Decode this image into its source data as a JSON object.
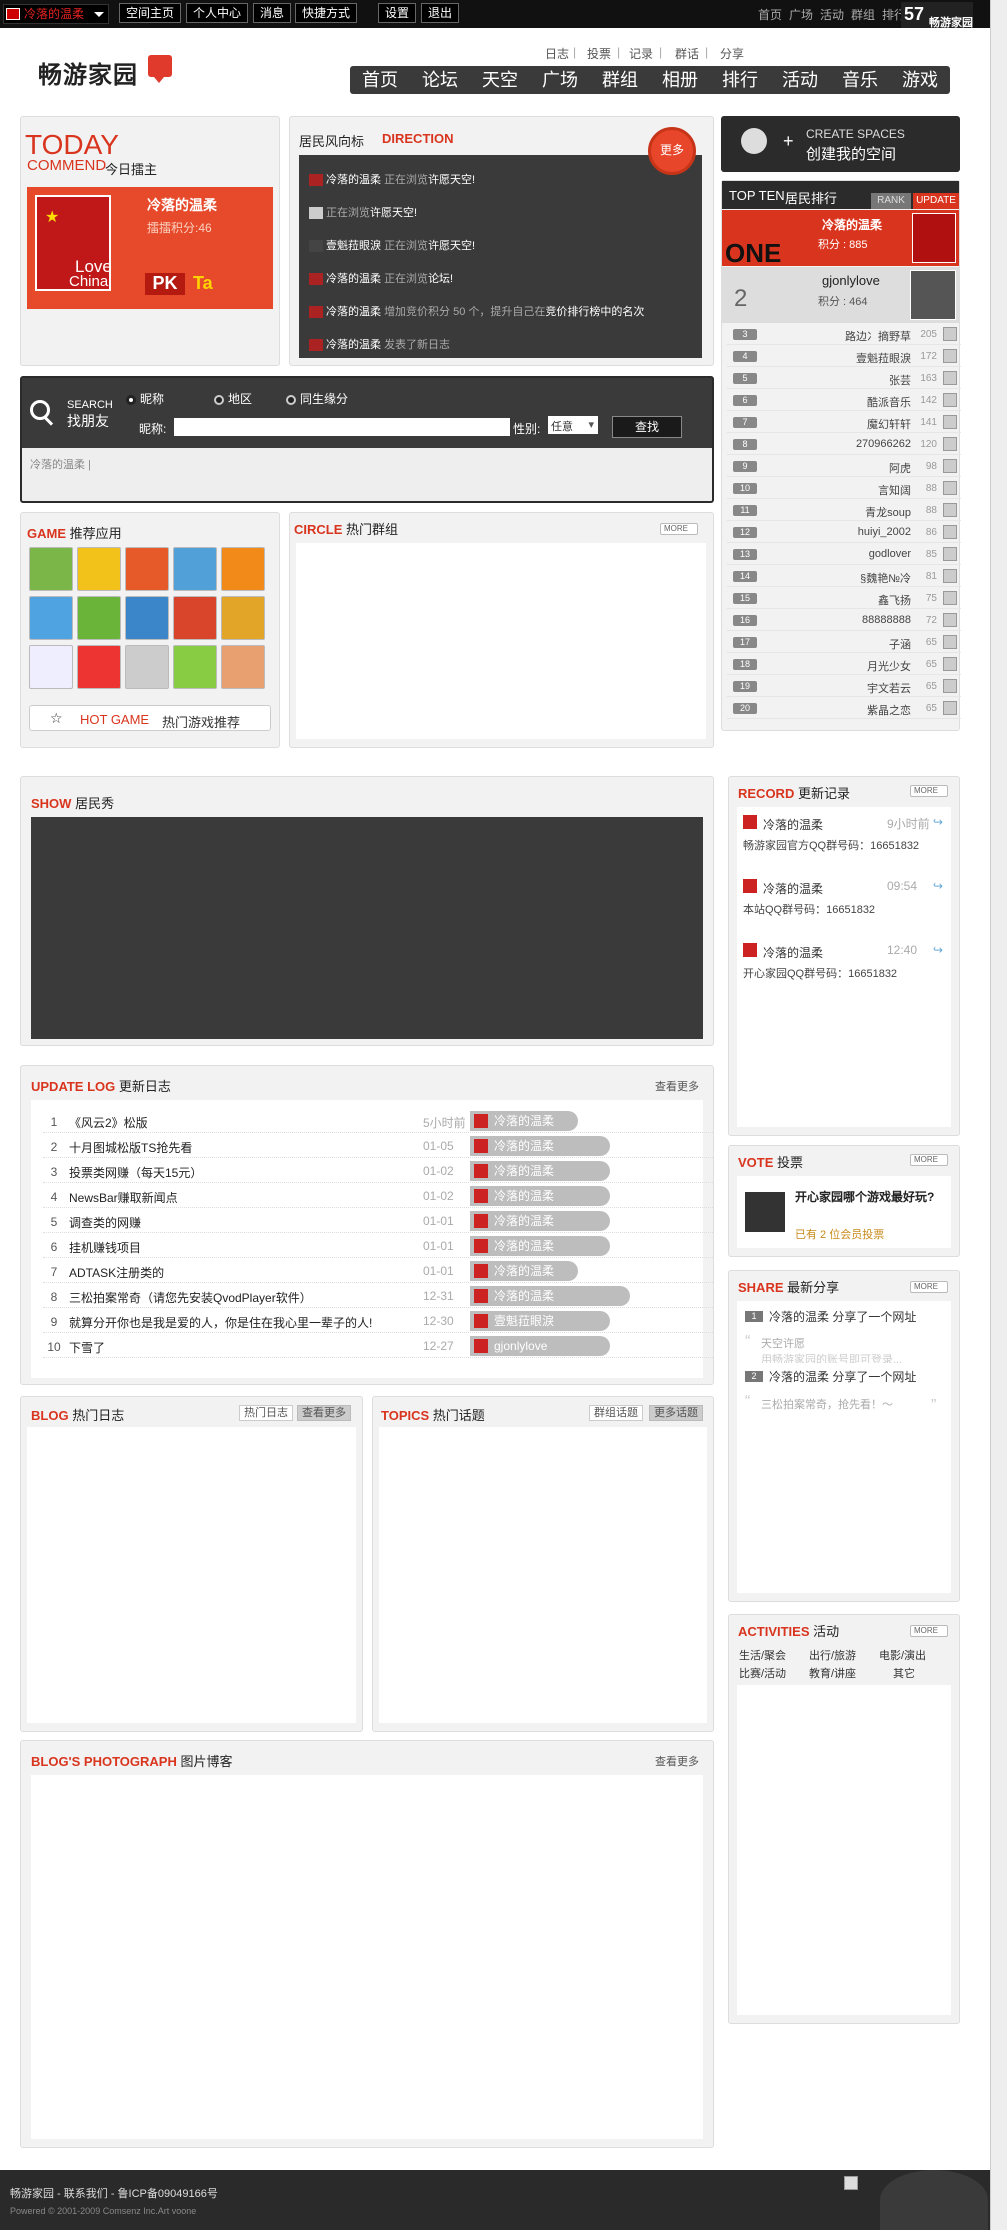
{
  "topbar": {
    "user": "冷落的温柔",
    "links": [
      "空间主页",
      "个人中心",
      "消息",
      "快捷方式",
      "设置",
      "退出"
    ],
    "right_links": [
      "首页",
      "广场",
      "活动",
      "群组",
      "排行"
    ],
    "brand": "57",
    "brand_sub": "畅游家园"
  },
  "logo": {
    "text": "畅游家园"
  },
  "subnav": [
    "日志",
    "投票",
    "记录",
    "群话",
    "分享"
  ],
  "mainnav": [
    "首页",
    "论坛",
    "天空",
    "广场",
    "群组",
    "相册",
    "排行",
    "活动",
    "音乐",
    "游戏"
  ],
  "today": {
    "title": "TODAY",
    "sub_en": "COMMEND",
    "sub_cn": "今日擂主",
    "name": "冷落的温柔",
    "score_label": "擂擂积分:46",
    "img_text1": "Love",
    "img_text2": "China",
    "pk": "PK",
    "ta": "Ta"
  },
  "direction": {
    "title_cn": "居民风向标",
    "title_en": "DIRECTION",
    "badge": "更多",
    "items": [
      {
        "user": "冷落的温柔",
        "action": "正在浏览",
        "target": "许愿天空!"
      },
      {
        "user": "",
        "action": "正在浏览",
        "target": "许愿天空!"
      },
      {
        "user": "壹魁菈眼淚",
        "action": "正在浏览",
        "target": "许愿天空!"
      },
      {
        "user": "冷落的温柔",
        "action": "正在浏览",
        "target": "论坛!"
      },
      {
        "user": "冷落的温柔",
        "action": "增加竞价积分 50 个，提升自己在",
        "target": "竞价排行榜中的名次"
      },
      {
        "user": "冷落的温柔",
        "action": "发表了新日志",
        "target": ""
      }
    ]
  },
  "create_spaces": {
    "en": "CREATE SPACES",
    "cn": "创建我的空间"
  },
  "search": {
    "en": "SEARCH",
    "cn": "找朋友",
    "options": [
      "昵称",
      "地区",
      "同生缘分"
    ],
    "nick_label": "昵称:",
    "gender_label": "性别:",
    "gender_value": "任意",
    "button": "查找",
    "history": "冷落的温柔 |"
  },
  "topten": {
    "title_en": "TOP TEN",
    "title_cn": "居民排行",
    "tabs": [
      "RANK",
      "UPDATE"
    ],
    "first": {
      "rank_word": "ONE",
      "name": "冷落的温柔",
      "score": "积分 : 885"
    },
    "second": {
      "rank": "2",
      "name": "gjonlylove",
      "score": "积分 : 464"
    },
    "rows": [
      {
        "rank": "3",
        "name": "路边冫摘野草",
        "score": "205"
      },
      {
        "rank": "4",
        "name": "壹魁菈眼淚",
        "score": "172"
      },
      {
        "rank": "5",
        "name": "张芸",
        "score": "163"
      },
      {
        "rank": "6",
        "name": "酷派音乐",
        "score": "142"
      },
      {
        "rank": "7",
        "name": "魔幻轩轩",
        "score": "141"
      },
      {
        "rank": "8",
        "name": "270966262",
        "score": "120"
      },
      {
        "rank": "9",
        "name": "阿虎",
        "score": "98"
      },
      {
        "rank": "10",
        "name": "言知阔",
        "score": "88"
      },
      {
        "rank": "11",
        "name": "青龙soup",
        "score": "88"
      },
      {
        "rank": "12",
        "name": "huiyi_2002",
        "score": "86"
      },
      {
        "rank": "13",
        "name": "godlover",
        "score": "85"
      },
      {
        "rank": "14",
        "name": "§魏艳№冷",
        "score": "81"
      },
      {
        "rank": "15",
        "name": "鑫飞扬",
        "score": "75"
      },
      {
        "rank": "16",
        "name": "88888888",
        "score": "72"
      },
      {
        "rank": "17",
        "name": "子涵",
        "score": "65"
      },
      {
        "rank": "18",
        "name": "月光少女",
        "score": "65"
      },
      {
        "rank": "19",
        "name": "宇文若云",
        "score": "65"
      },
      {
        "rank": "20",
        "name": "紫晶之恋",
        "score": "65"
      }
    ]
  },
  "game": {
    "title_en": "GAME",
    "title_cn": "推荐应用",
    "hot_en": "HOT GAME",
    "hot_cn": "热门游戏推荐"
  },
  "circle": {
    "title_en": "CIRCLE",
    "title_cn": "热门群组",
    "more": "MORE"
  },
  "show": {
    "title_en": "SHOW",
    "title_cn": "居民秀"
  },
  "record": {
    "title_en": "RECORD",
    "title_cn": "更新记录",
    "more": "MORE",
    "items": [
      {
        "user": "冷落的温柔",
        "time": "9小时前",
        "text": "畅游家园官方QQ群号码：16651832"
      },
      {
        "user": "冷落的温柔",
        "time": "09:54",
        "text": "本站QQ群号码：16651832"
      },
      {
        "user": "冷落的温柔",
        "time": "12:40",
        "text": "开心家园QQ群号码：16651832"
      }
    ]
  },
  "updatelog": {
    "title_en": "UPDATE LOG",
    "title_cn": "更新日志",
    "more": "查看更多",
    "rows": [
      {
        "n": "1",
        "title": "《风云2》松版",
        "date": "5小时前",
        "user": "冷落的温柔"
      },
      {
        "n": "2",
        "title": "十月图城松版TS抢先看",
        "date": "01-05",
        "user": "冷落的温柔"
      },
      {
        "n": "3",
        "title": "投票类网赚（每天15元）",
        "date": "01-02",
        "user": "冷落的温柔"
      },
      {
        "n": "4",
        "title": "NewsBar赚取新闻点",
        "date": "01-02",
        "user": "冷落的温柔"
      },
      {
        "n": "5",
        "title": "调查类的网赚",
        "date": "01-01",
        "user": "冷落的温柔"
      },
      {
        "n": "6",
        "title": "挂机赚钱项目",
        "date": "01-01",
        "user": "冷落的温柔"
      },
      {
        "n": "7",
        "title": "ADTASK注册类的",
        "date": "01-01",
        "user": "冷落的温柔"
      },
      {
        "n": "8",
        "title": "三松拍案常奇（请您先安装QvodPlayer软件）",
        "date": "12-31",
        "user": "冷落的温柔"
      },
      {
        "n": "9",
        "title": "就算分开你也是我是爱的人，你是住在我心里一辈子的人!",
        "date": "12-30",
        "user": "壹魁菈眼淚"
      },
      {
        "n": "10",
        "title": "下雪了",
        "date": "12-27",
        "user": "gjonlylove"
      }
    ]
  },
  "vote": {
    "title_en": "VOTE",
    "title_cn": "投票",
    "more": "MORE",
    "question": "开心家园哪个游戏最好玩?",
    "stat": "已有 2 位会员投票"
  },
  "share": {
    "title_en": "SHARE",
    "title_cn": "最新分享",
    "more": "MORE",
    "items": [
      {
        "n": "1",
        "text": "冷落的温柔 分享了一个网址",
        "quote": "天空许愿",
        "quote2": "用畅游家园的账号即可登录..."
      },
      {
        "n": "2",
        "text": "冷落的温柔 分享了一个网址",
        "quote": "三松拍案常奇，抢先看！～"
      }
    ]
  },
  "blog": {
    "title_en": "BLOG",
    "title_cn": "热门日志",
    "tab1": "热门日志",
    "tab2": "查看更多"
  },
  "topics": {
    "title_en": "TOPICS",
    "title_cn": "热门话题",
    "tab1": "群组话题",
    "tab2": "更多话题"
  },
  "activities": {
    "title_en": "ACTIVITIES",
    "title_cn": "活动",
    "more": "MORE",
    "items": [
      "生活/聚会",
      "出行/旅游",
      "电影/演出",
      "比赛/活动",
      "教育/讲座",
      "其它"
    ]
  },
  "photo": {
    "title_en": "BLOG'S PHOTOGRAPH",
    "title_cn": "图片博客",
    "more": "查看更多"
  },
  "footer": {
    "line1": "畅游家园 - 联系我们  - 鲁ICP备09049166号",
    "line2": "Powered © 2001-2009 Comsenz Inc.Art voone"
  }
}
